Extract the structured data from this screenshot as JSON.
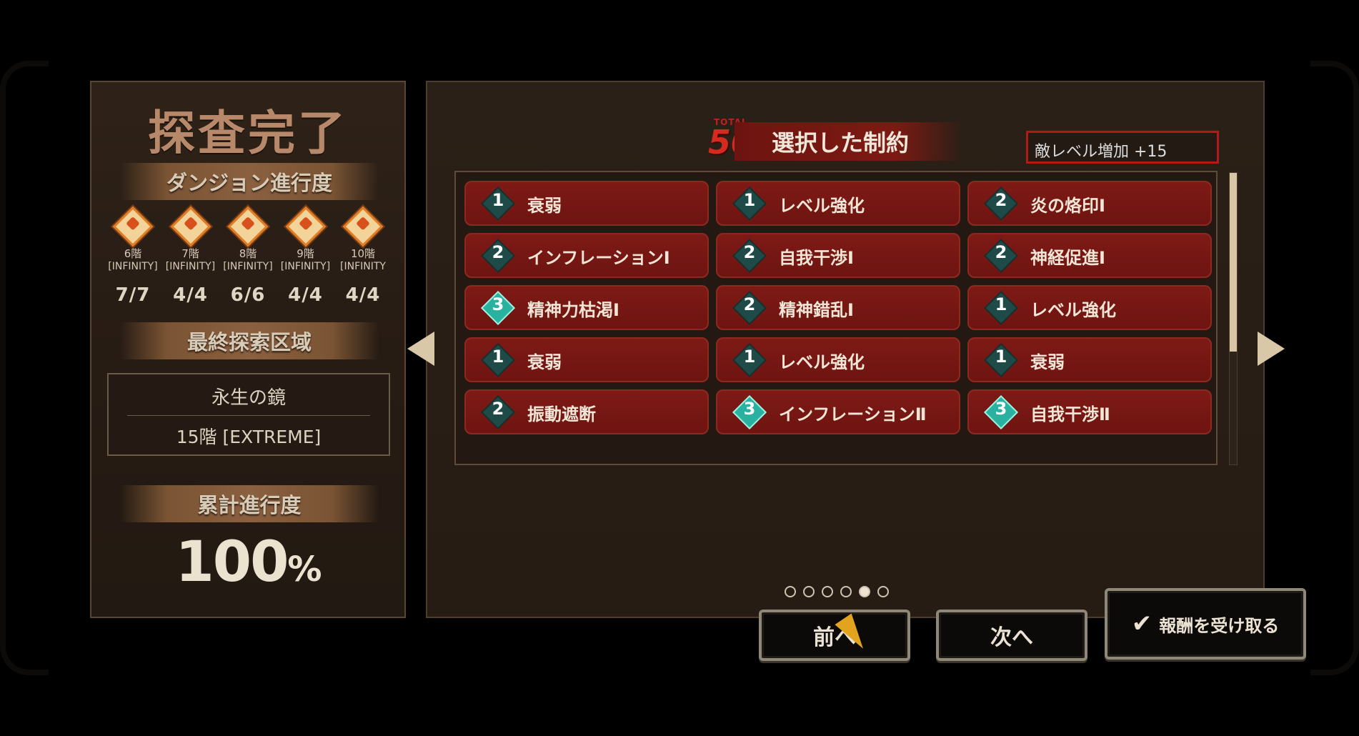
{
  "left": {
    "title": "探査完了",
    "dungeon_progress_label": "ダンジョン進行度",
    "floors": [
      {
        "name": "6階",
        "difficulty": "[INFINITY]",
        "count": "7/7"
      },
      {
        "name": "7階",
        "difficulty": "[INFINITY]",
        "count": "4/4"
      },
      {
        "name": "8階",
        "difficulty": "[INFINITY]",
        "count": "6/6"
      },
      {
        "name": "9階",
        "difficulty": "[INFINITY]",
        "count": "4/4"
      },
      {
        "name": "10階",
        "difficulty": "[INFINITY",
        "count": "4/4"
      }
    ],
    "final_area_label": "最終探索区域",
    "final_area_name": "永生の鏡",
    "final_area_floor": "15階 [EXTREME]",
    "total_progress_label": "累計進行度",
    "total_progress_value": "100",
    "total_progress_unit": "%"
  },
  "right": {
    "total_label": "TOTAL",
    "total_value": "50",
    "header_title": "選択した制約",
    "enemy_level": "敵レベル増加 +15",
    "restrictions": [
      {
        "level": "1",
        "label": "衰弱"
      },
      {
        "level": "1",
        "label": "レベル強化"
      },
      {
        "level": "2",
        "label": "炎の烙印Ⅰ"
      },
      {
        "level": "2",
        "label": "インフレーションⅠ"
      },
      {
        "level": "2",
        "label": "自我干渉Ⅰ"
      },
      {
        "level": "2",
        "label": "神経促進Ⅰ"
      },
      {
        "level": "3",
        "label": "精神力枯渇Ⅰ"
      },
      {
        "level": "2",
        "label": "精神錯乱Ⅰ"
      },
      {
        "level": "1",
        "label": "レベル強化"
      },
      {
        "level": "1",
        "label": "衰弱"
      },
      {
        "level": "1",
        "label": "レベル強化"
      },
      {
        "level": "1",
        "label": "衰弱"
      },
      {
        "level": "2",
        "label": "振動遮断"
      },
      {
        "level": "3",
        "label": "インフレーションⅡ"
      },
      {
        "level": "3",
        "label": "自我干渉Ⅱ"
      }
    ],
    "page_count": 6,
    "active_page": 5
  },
  "buttons": {
    "prev": "前へ",
    "next": "次へ",
    "claim": "報酬を受け取る"
  },
  "colors": {
    "restriction_bg": "#7a1814",
    "accent_red": "#d42a20",
    "badge_teal": "#2ab2a0"
  }
}
